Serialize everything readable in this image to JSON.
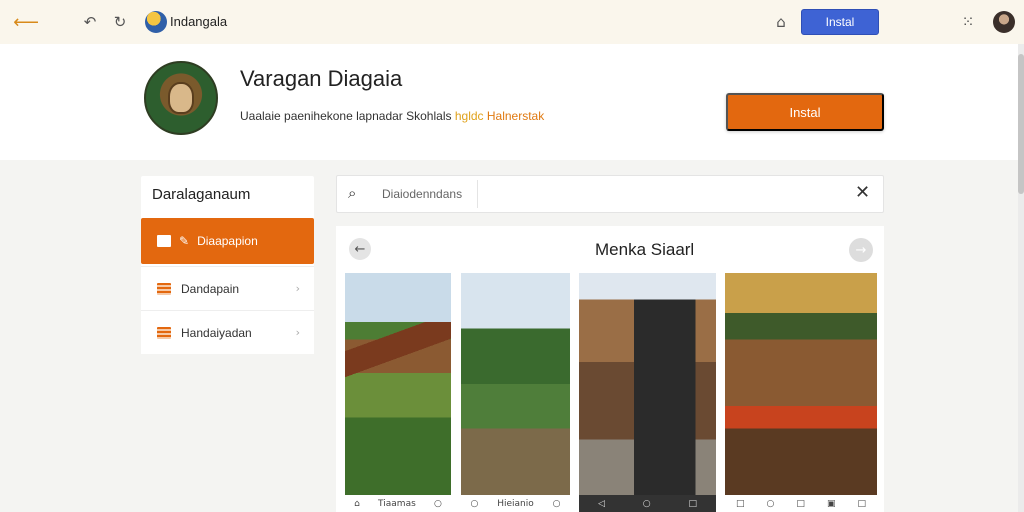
{
  "topbar": {
    "site_title": "Indangala",
    "install_label": "Instal"
  },
  "header": {
    "app_name": "Varagan Diagaia",
    "description_main": "Uaalaie paenihekone lapnadar Skohlals",
    "description_highlight1": "hgldc",
    "description_highlight2": "Halnerstak",
    "install_label": "Instal"
  },
  "sidebar": {
    "title": "Daralaganaum",
    "items": [
      {
        "label": "Diaapapion"
      },
      {
        "label": "Dandapain"
      },
      {
        "label": "Handaiyadan"
      }
    ]
  },
  "search": {
    "value": "Diaiodenndans"
  },
  "gallery": {
    "title": "Menka Siaarl",
    "screenshots": [
      {
        "nav_label": "Tiaamas"
      },
      {
        "nav_label": "Hieianio"
      },
      {
        "nav_label": ""
      },
      {
        "nav_label": ""
      }
    ]
  },
  "colors": {
    "accent_orange": "#e3680f",
    "accent_blue": "#3e63d4",
    "highlight_yellow": "#e0a21b"
  }
}
